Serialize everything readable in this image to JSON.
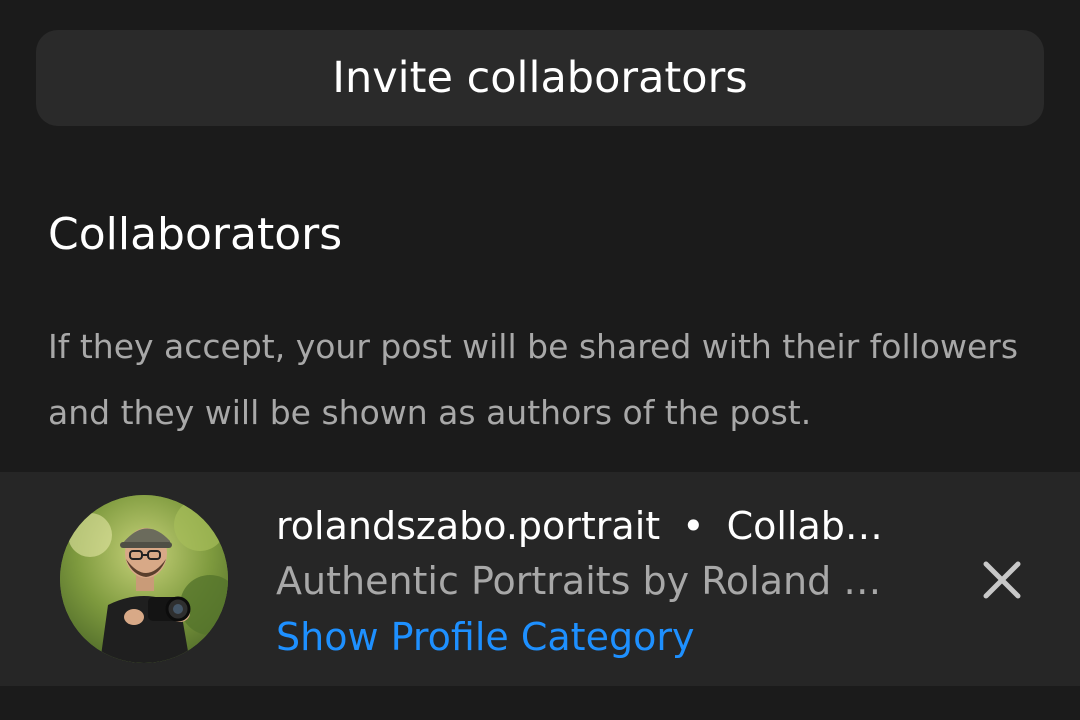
{
  "invite": {
    "label": "Invite collaborators"
  },
  "section": {
    "title": "Collaborators",
    "description": "If they accept, your post will be shared with their followers and they will be shown as authors of the post."
  },
  "collaborator": {
    "username": "rolandszabo.portrait",
    "separator": "•",
    "status": "Collab…",
    "full_name": "Authentic Portraits by Roland …",
    "category_link": "Show Profile Category",
    "avatar_icon": "profile-photo-avatar",
    "remove_icon": "close-icon"
  },
  "colors": {
    "background": "#1b1b1b",
    "button_bg": "#2a2a2a",
    "row_bg": "#262626",
    "link": "#1e90ff",
    "muted_text": "#a8a8a8"
  }
}
